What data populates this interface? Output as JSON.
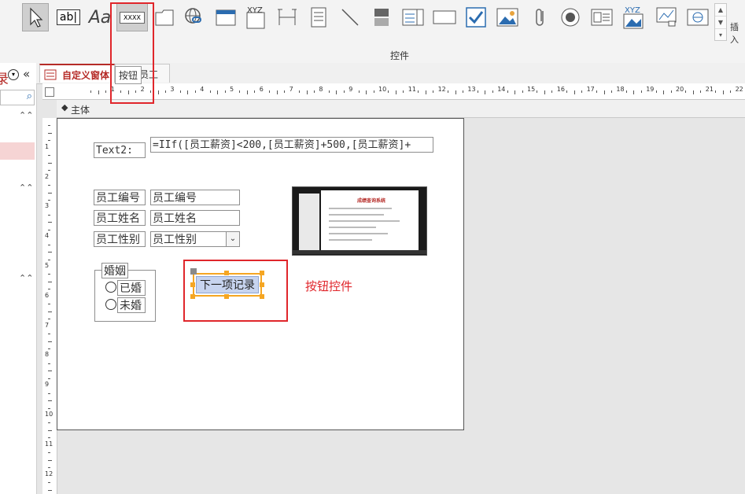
{
  "ribbon": {
    "tooltip": "按钮",
    "button_tool_label": "XXXX",
    "group_label": "控件",
    "insert_label": "插入",
    "textbox_tool_label": "ab|",
    "label_tool_label": "Aa",
    "xyz_label": "XYZ"
  },
  "nav": {
    "partial_title": "录"
  },
  "tabs": {
    "active_label": "自定义窗体",
    "second_label": "员工"
  },
  "section": {
    "label": "主体"
  },
  "ruler": {
    "h_numbers": [
      "1",
      "2",
      "3",
      "4",
      "5",
      "6",
      "7",
      "8",
      "9",
      "10",
      "11",
      "12",
      "13",
      "14",
      "15",
      "16",
      "17",
      "18",
      "19",
      "20",
      "21",
      "22",
      "23"
    ],
    "v_numbers": [
      "1",
      "2",
      "3",
      "4",
      "5",
      "6",
      "7",
      "8",
      "9",
      "10",
      "11",
      "12"
    ]
  },
  "form": {
    "text2_label": "Text2:",
    "text2_expr": "=IIf([员工薪资]<200,[员工薪资]+500,[员工薪资]+",
    "fields": [
      {
        "label": "员工编号",
        "value": "员工编号"
      },
      {
        "label": "员工姓名",
        "value": "员工姓名"
      },
      {
        "label": "员工性别",
        "value": "员工性别"
      }
    ],
    "group_title": "婚姻",
    "options": [
      "已婚",
      "未婚"
    ],
    "button_label": "下一项记录",
    "annotation": "按钮控件"
  },
  "thumbnail": {
    "title": "成绩查询系统"
  },
  "colors": {
    "highlight_red": "#e0262b",
    "tab_red": "#b52b27",
    "button_fill": "#c7d4ef",
    "selection_orange": "#f5a623"
  }
}
